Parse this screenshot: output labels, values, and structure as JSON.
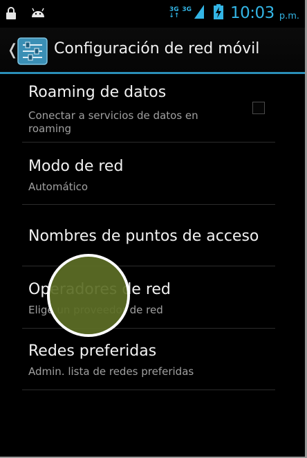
{
  "status_bar": {
    "left_icons": [
      "lock-icon",
      "android-icon"
    ],
    "network_labels": [
      "3G",
      "3G"
    ],
    "time": "10:03",
    "ampm": "p.m.",
    "accent_color": "#33b5e5"
  },
  "action_bar": {
    "title": "Configuración de red móvil",
    "icon": "settings-sliders-icon",
    "accent_color": "#2a8fb8"
  },
  "items": [
    {
      "title": "Roaming de datos",
      "summary": "Conectar a servicios de datos en roaming",
      "checked": false
    },
    {
      "title": "Modo de red",
      "summary": "Automático"
    },
    {
      "title": "Nombres de puntos de acceso",
      "summary": ""
    },
    {
      "title": "Operadores de red",
      "summary": "Elige un proveedor de red"
    },
    {
      "title": "Redes preferidas",
      "summary": "Admin. lista de redes preferidas"
    }
  ]
}
